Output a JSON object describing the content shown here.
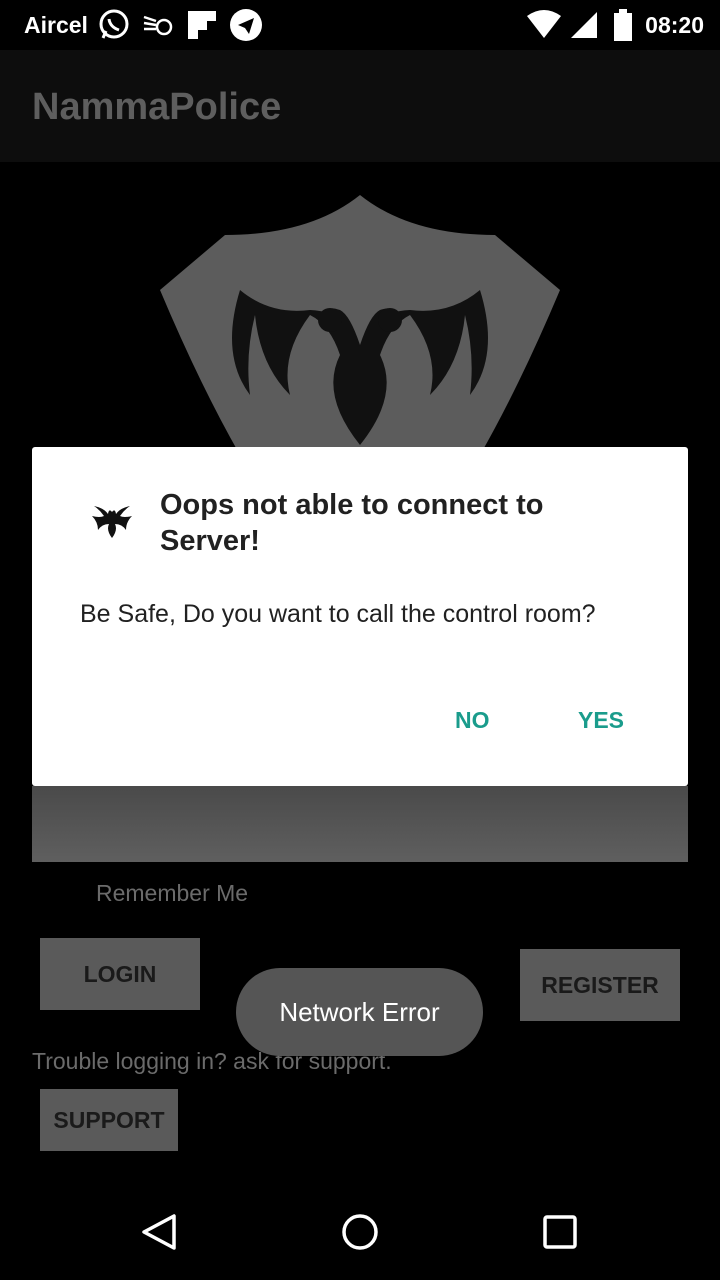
{
  "status_bar": {
    "carrier": "Aircel",
    "time": "08:20",
    "icons": [
      "whatsapp-icon",
      "notification-icon",
      "flipboard-icon",
      "telegram-icon",
      "wifi-icon",
      "signal-icon",
      "battery-icon"
    ]
  },
  "app_bar": {
    "title": "NammaPolice"
  },
  "background": {
    "remember_me": "Remember Me",
    "login_label": "LOGIN",
    "register_label": "REGISTER",
    "trouble_text": "Trouble logging in? ask for support.",
    "support_label": "SUPPORT"
  },
  "toast": {
    "message": "Network Error"
  },
  "dialog": {
    "title": "Oops not able to connect to Server!",
    "message": "Be Safe, Do you want to call the control room?",
    "no_label": "NO",
    "yes_label": "YES"
  },
  "colors": {
    "accent": "#1a9c8c",
    "toast_bg": "#555555",
    "app_bar_bg": "#0d0d0d"
  }
}
